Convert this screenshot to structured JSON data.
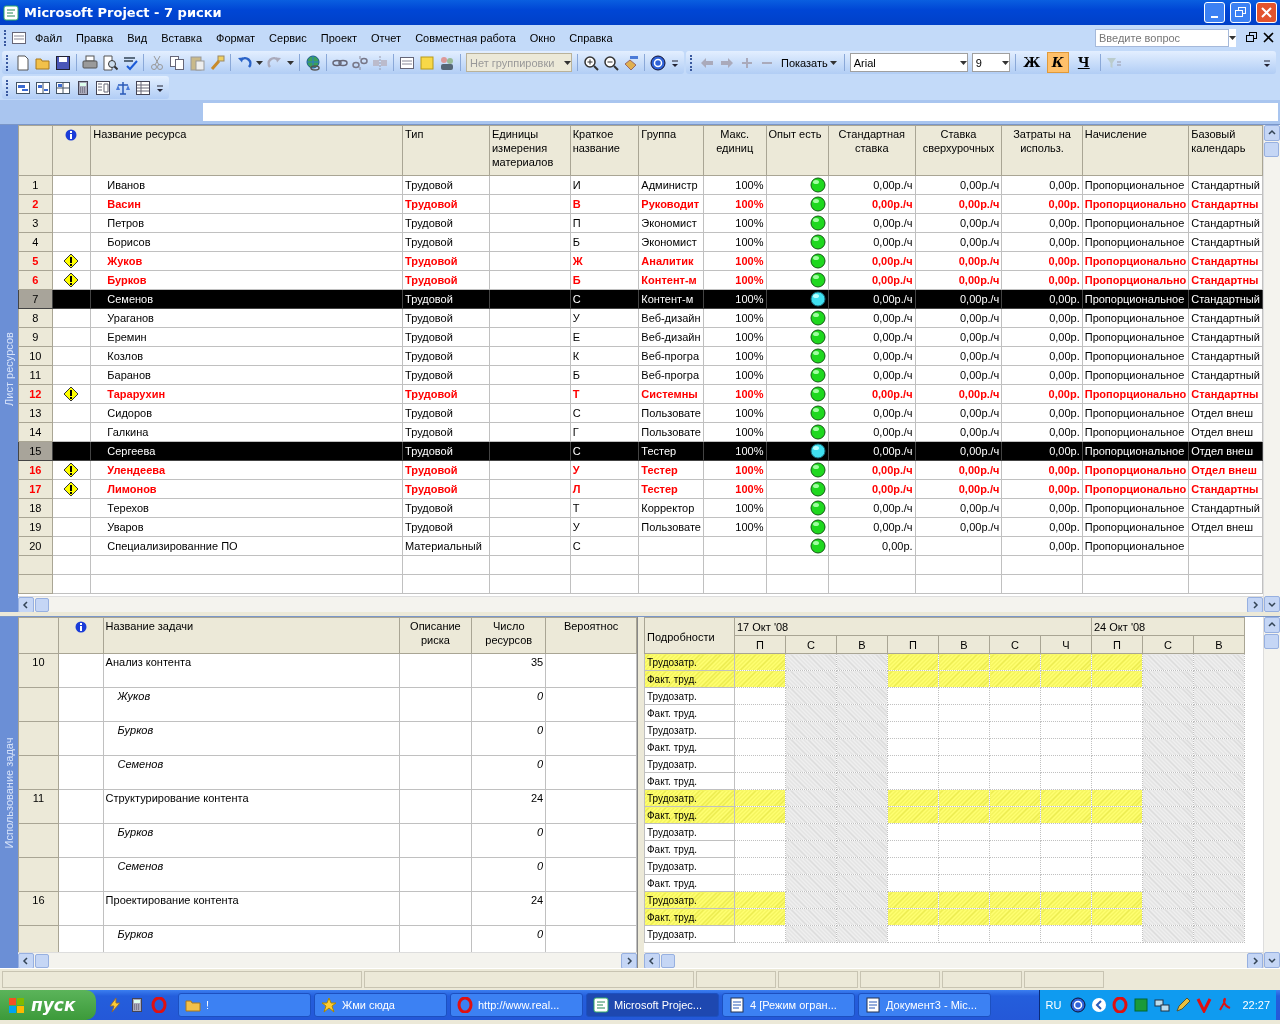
{
  "window": {
    "title": "Microsoft Project - 7 риски"
  },
  "menu": [
    "Файл",
    "Правка",
    "Вид",
    "Вставка",
    "Формат",
    "Сервис",
    "Проект",
    "Отчет",
    "Совместная работа",
    "Окно",
    "Справка"
  ],
  "help_search": {
    "placeholder": "Введите вопрос"
  },
  "toolbar": {
    "grouping": {
      "value": "Нет группировки",
      "disabled": true
    },
    "show_button": "Показать",
    "font": "Arial",
    "font_size": "9",
    "format_buttons": [
      {
        "label": "Ж",
        "kind": "bold",
        "selected": false
      },
      {
        "label": "К",
        "kind": "italic",
        "selected": true
      },
      {
        "label": "Ч",
        "kind": "underline",
        "selected": false
      }
    ]
  },
  "resource_sheet": {
    "side_label": "Лист ресурсов",
    "columns": [
      {
        "label": "Название ресурса",
        "kind": "name"
      },
      {
        "label": "Тип",
        "kind": "text"
      },
      {
        "label": "Единицы измерения материалов",
        "kind": "text"
      },
      {
        "label": "Краткое название",
        "kind": "text"
      },
      {
        "label": "Группа",
        "kind": "text"
      },
      {
        "label": "Макс. единиц",
        "kind": "number"
      },
      {
        "label": "Опыт есть",
        "kind": "indicator"
      },
      {
        "label": "Стандартная ставка",
        "kind": "number"
      },
      {
        "label": "Ставка сверхурочных",
        "kind": "number"
      },
      {
        "label": "Затраты на использ.",
        "kind": "number"
      },
      {
        "label": "Начисление",
        "kind": "text"
      },
      {
        "label": "Базовый календарь",
        "kind": "text"
      }
    ],
    "rows": [
      {
        "id": "1",
        "warning": false,
        "overallocated": false,
        "selected": false,
        "experienced": true,
        "cells": [
          "Иванов",
          "Трудовой",
          null,
          "И",
          "Администр",
          "100%",
          null,
          "0,00р./ч",
          "0,00р./ч",
          "0,00р.",
          "Пропорциональное",
          "Стандартный"
        ]
      },
      {
        "id": "2",
        "warning": false,
        "overallocated": true,
        "selected": false,
        "experienced": true,
        "cells": [
          "Васин",
          "Трудовой",
          null,
          "В",
          "Руководит",
          "100%",
          null,
          "0,00р./ч",
          "0,00р./ч",
          "0,00р.",
          "Пропорционально",
          "Стандартны"
        ]
      },
      {
        "id": "3",
        "warning": false,
        "overallocated": false,
        "selected": false,
        "experienced": true,
        "cells": [
          "Петров",
          "Трудовой",
          null,
          "П",
          "Экономист",
          "100%",
          null,
          "0,00р./ч",
          "0,00р./ч",
          "0,00р.",
          "Пропорциональное",
          "Стандартный"
        ]
      },
      {
        "id": "4",
        "warning": false,
        "overallocated": false,
        "selected": false,
        "experienced": true,
        "cells": [
          "Борисов",
          "Трудовой",
          null,
          "Б",
          "Экономист",
          "100%",
          null,
          "0,00р./ч",
          "0,00р./ч",
          "0,00р.",
          "Пропорциональное",
          "Стандартный"
        ]
      },
      {
        "id": "5",
        "warning": true,
        "overallocated": true,
        "selected": false,
        "experienced": true,
        "cells": [
          "Жуков",
          "Трудовой",
          null,
          "Ж",
          "Аналитик",
          "100%",
          null,
          "0,00р./ч",
          "0,00р./ч",
          "0,00р.",
          "Пропорционально",
          "Стандартны"
        ]
      },
      {
        "id": "6",
        "warning": true,
        "overallocated": true,
        "selected": false,
        "experienced": true,
        "cells": [
          "Бурков",
          "Трудовой",
          null,
          "Б",
          "Контент-м",
          "100%",
          null,
          "0,00р./ч",
          "0,00р./ч",
          "0,00р.",
          "Пропорционально",
          "Стандартны"
        ]
      },
      {
        "id": "7",
        "warning": false,
        "overallocated": false,
        "selected": true,
        "experienced": true,
        "cells": [
          "Семенов",
          "Трудовой",
          null,
          "С",
          "Контент-м",
          "100%",
          null,
          "0,00р./ч",
          "0,00р./ч",
          "0,00р.",
          "Пропорциональное",
          "Стандартный"
        ]
      },
      {
        "id": "8",
        "warning": false,
        "overallocated": false,
        "selected": false,
        "experienced": true,
        "cells": [
          "Ураганов",
          "Трудовой",
          null,
          "У",
          "Веб-дизайн",
          "100%",
          null,
          "0,00р./ч",
          "0,00р./ч",
          "0,00р.",
          "Пропорциональное",
          "Стандартный"
        ]
      },
      {
        "id": "9",
        "warning": false,
        "overallocated": false,
        "selected": false,
        "experienced": true,
        "cells": [
          "Еремин",
          "Трудовой",
          null,
          "Е",
          "Веб-дизайн",
          "100%",
          null,
          "0,00р./ч",
          "0,00р./ч",
          "0,00р.",
          "Пропорциональное",
          "Стандартный"
        ]
      },
      {
        "id": "10",
        "warning": false,
        "overallocated": false,
        "selected": false,
        "experienced": true,
        "cells": [
          "Козлов",
          "Трудовой",
          null,
          "К",
          "Веб-програ",
          "100%",
          null,
          "0,00р./ч",
          "0,00р./ч",
          "0,00р.",
          "Пропорциональное",
          "Стандартный"
        ]
      },
      {
        "id": "11",
        "warning": false,
        "overallocated": false,
        "selected": false,
        "experienced": true,
        "cells": [
          "Баранов",
          "Трудовой",
          null,
          "Б",
          "Веб-програ",
          "100%",
          null,
          "0,00р./ч",
          "0,00р./ч",
          "0,00р.",
          "Пропорциональное",
          "Стандартный"
        ]
      },
      {
        "id": "12",
        "warning": true,
        "overallocated": true,
        "selected": false,
        "experienced": true,
        "cells": [
          "Тарарухин",
          "Трудовой",
          null,
          "Т",
          "Системны",
          "100%",
          null,
          "0,00р./ч",
          "0,00р./ч",
          "0,00р.",
          "Пропорционально",
          "Стандартны"
        ]
      },
      {
        "id": "13",
        "warning": false,
        "overallocated": false,
        "selected": false,
        "experienced": true,
        "cells": [
          "Сидоров",
          "Трудовой",
          null,
          "С",
          "Пользовате",
          "100%",
          null,
          "0,00р./ч",
          "0,00р./ч",
          "0,00р.",
          "Пропорциональное",
          "Отдел внеш"
        ]
      },
      {
        "id": "14",
        "warning": false,
        "overallocated": false,
        "selected": false,
        "experienced": true,
        "cells": [
          "Галкина",
          "Трудовой",
          null,
          "Г",
          "Пользовате",
          "100%",
          null,
          "0,00р./ч",
          "0,00р./ч",
          "0,00р.",
          "Пропорциональное",
          "Отдел внеш"
        ]
      },
      {
        "id": "15",
        "warning": false,
        "overallocated": false,
        "selected": true,
        "experienced": true,
        "cells": [
          "Сергеева",
          "Трудовой",
          null,
          "С",
          "Тестер",
          "100%",
          null,
          "0,00р./ч",
          "0,00р./ч",
          "0,00р.",
          "Пропорциональное",
          "Отдел внеш"
        ]
      },
      {
        "id": "16",
        "warning": true,
        "overallocated": true,
        "selected": false,
        "experienced": true,
        "cells": [
          "Улендеева",
          "Трудовой",
          null,
          "У",
          "Тестер",
          "100%",
          null,
          "0,00р./ч",
          "0,00р./ч",
          "0,00р.",
          "Пропорционально",
          "Отдел внеш"
        ]
      },
      {
        "id": "17",
        "warning": true,
        "overallocated": true,
        "selected": false,
        "experienced": true,
        "cells": [
          "Лимонов",
          "Трудовой",
          null,
          "Л",
          "Тестер",
          "100%",
          null,
          "0,00р./ч",
          "0,00р./ч",
          "0,00р.",
          "Пропорционально",
          "Стандартны"
        ]
      },
      {
        "id": "18",
        "warning": false,
        "overallocated": false,
        "selected": false,
        "experienced": true,
        "cells": [
          "Терехов",
          "Трудовой",
          null,
          "Т",
          "Корректор",
          "100%",
          null,
          "0,00р./ч",
          "0,00р./ч",
          "0,00р.",
          "Пропорциональное",
          "Стандартный"
        ]
      },
      {
        "id": "19",
        "warning": false,
        "overallocated": false,
        "selected": false,
        "experienced": true,
        "cells": [
          "Уваров",
          "Трудовой",
          null,
          "У",
          "Пользовате",
          "100%",
          null,
          "0,00р./ч",
          "0,00р./ч",
          "0,00р.",
          "Пропорциональное",
          "Отдел внеш"
        ]
      },
      {
        "id": "20",
        "warning": false,
        "overallocated": false,
        "selected": false,
        "experienced": true,
        "cells": [
          "Специализированние ПО",
          "Материальный",
          null,
          "С",
          null,
          null,
          null,
          "0,00р.",
          null,
          "0,00р.",
          "Пропорциональное",
          null
        ]
      }
    ]
  },
  "task_usage": {
    "side_label": "Использование задач",
    "columns": [
      {
        "label": "Название задачи",
        "kind": "name"
      },
      {
        "label": "Описание риска",
        "kind": "number"
      },
      {
        "label": "Число ресурсов",
        "kind": "number"
      },
      {
        "label": "Вероятнос",
        "kind": "number"
      }
    ],
    "rows": [
      {
        "id": "10",
        "kind": "task",
        "cells": [
          "Анализ контента",
          null,
          "35",
          null
        ],
        "details": [
          "Трудозатр.",
          "Факт. труд."
        ]
      },
      {
        "kind": "assignment",
        "cells": [
          "Жуков",
          null,
          "0",
          null
        ],
        "details": [
          "Трудозатр.",
          "Факт. труд."
        ]
      },
      {
        "kind": "assignment",
        "cells": [
          "Бурков",
          null,
          "0",
          null
        ],
        "details": [
          "Трудозатр.",
          "Факт. труд."
        ]
      },
      {
        "kind": "assignment",
        "cells": [
          "Семенов",
          null,
          "0",
          null
        ],
        "details": [
          "Трудозатр.",
          "Факт. труд."
        ]
      },
      {
        "id": "11",
        "kind": "task",
        "cells": [
          "Структурирование контента",
          null,
          "24",
          null
        ],
        "details": [
          "Трудозатр.",
          "Факт. труд."
        ]
      },
      {
        "kind": "assignment",
        "cells": [
          "Бурков",
          null,
          "0",
          null
        ],
        "details": [
          "Трудозатр.",
          "Факт. труд."
        ]
      },
      {
        "kind": "assignment",
        "cells": [
          "Семенов",
          null,
          "0",
          null
        ],
        "details": [
          "Трудозатр.",
          "Факт. труд."
        ]
      },
      {
        "id": "16",
        "kind": "task",
        "cells": [
          "Проектирование контента",
          null,
          "24",
          null
        ],
        "details": [
          "Трудозатр.",
          "Факт. труд."
        ]
      },
      {
        "kind": "assignment",
        "cells": [
          "Бурков",
          null,
          "0",
          null
        ],
        "details": [
          "Трудозатр."
        ]
      }
    ],
    "timescale": {
      "details_header": "Подробности",
      "weeks": [
        {
          "label": "17 Окт '08",
          "days": [
            {
              "label": "П",
              "weekend": false
            },
            {
              "label": "С",
              "weekend": true
            },
            {
              "label": "В",
              "weekend": true
            },
            {
              "label": "П",
              "weekend": false
            },
            {
              "label": "В",
              "weekend": false
            },
            {
              "label": "С",
              "weekend": false
            },
            {
              "label": "Ч",
              "weekend": false
            }
          ]
        },
        {
          "label": "24 Окт '08",
          "days": [
            {
              "label": "П",
              "weekend": false
            },
            {
              "label": "С",
              "weekend": true
            },
            {
              "label": "В",
              "weekend": true
            }
          ]
        }
      ]
    }
  },
  "taskbar": {
    "start": "пуск",
    "tasks": [
      {
        "label": "!",
        "selected": false
      },
      {
        "label": "Жми сюда",
        "selected": false
      },
      {
        "label": "http://www.real...",
        "selected": false
      },
      {
        "label": "Microsoft Projec...",
        "selected": true
      },
      {
        "label": "4 [Режим огран...",
        "selected": false
      },
      {
        "label": "Документ3 - Mic...",
        "selected": false
      }
    ],
    "language": "RU",
    "clock": "22:27"
  }
}
